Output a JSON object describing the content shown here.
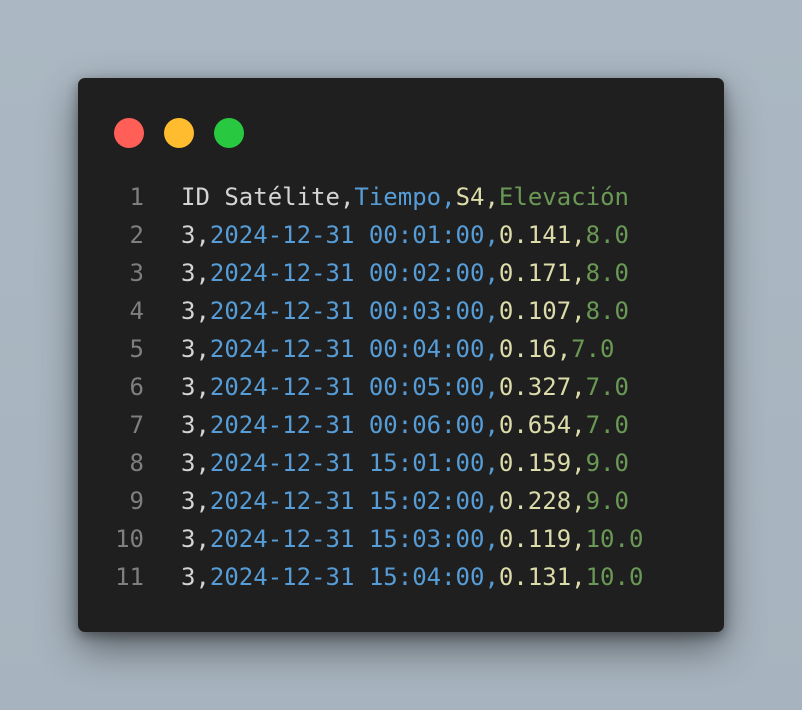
{
  "window": {
    "buttons": [
      "close",
      "minimize",
      "maximize"
    ],
    "colors": {
      "close": "#ff5f57",
      "minimize": "#febc2e",
      "maximize": "#28c840"
    }
  },
  "csv": {
    "header": {
      "id": "ID Satélite",
      "time": "Tiempo",
      "s4": "S4",
      "elev": "Elevación"
    },
    "rows": [
      {
        "id": "3",
        "time": "2024-12-31 00:01:00",
        "s4": "0.141",
        "elev": "8.0"
      },
      {
        "id": "3",
        "time": "2024-12-31 00:02:00",
        "s4": "0.171",
        "elev": "8.0"
      },
      {
        "id": "3",
        "time": "2024-12-31 00:03:00",
        "s4": "0.107",
        "elev": "8.0"
      },
      {
        "id": "3",
        "time": "2024-12-31 00:04:00",
        "s4": "0.16",
        "elev": "7.0"
      },
      {
        "id": "3",
        "time": "2024-12-31 00:05:00",
        "s4": "0.327",
        "elev": "7.0"
      },
      {
        "id": "3",
        "time": "2024-12-31 00:06:00",
        "s4": "0.654",
        "elev": "7.0"
      },
      {
        "id": "3",
        "time": "2024-12-31 15:01:00",
        "s4": "0.159",
        "elev": "9.0"
      },
      {
        "id": "3",
        "time": "2024-12-31 15:02:00",
        "s4": "0.228",
        "elev": "9.0"
      },
      {
        "id": "3",
        "time": "2024-12-31 15:03:00",
        "s4": "0.119",
        "elev": "10.0"
      },
      {
        "id": "3",
        "time": "2024-12-31 15:04:00",
        "s4": "0.131",
        "elev": "10.0"
      }
    ]
  },
  "line_numbers": [
    "1",
    "2",
    "3",
    "4",
    "5",
    "6",
    "7",
    "8",
    "9",
    "10",
    "11"
  ]
}
